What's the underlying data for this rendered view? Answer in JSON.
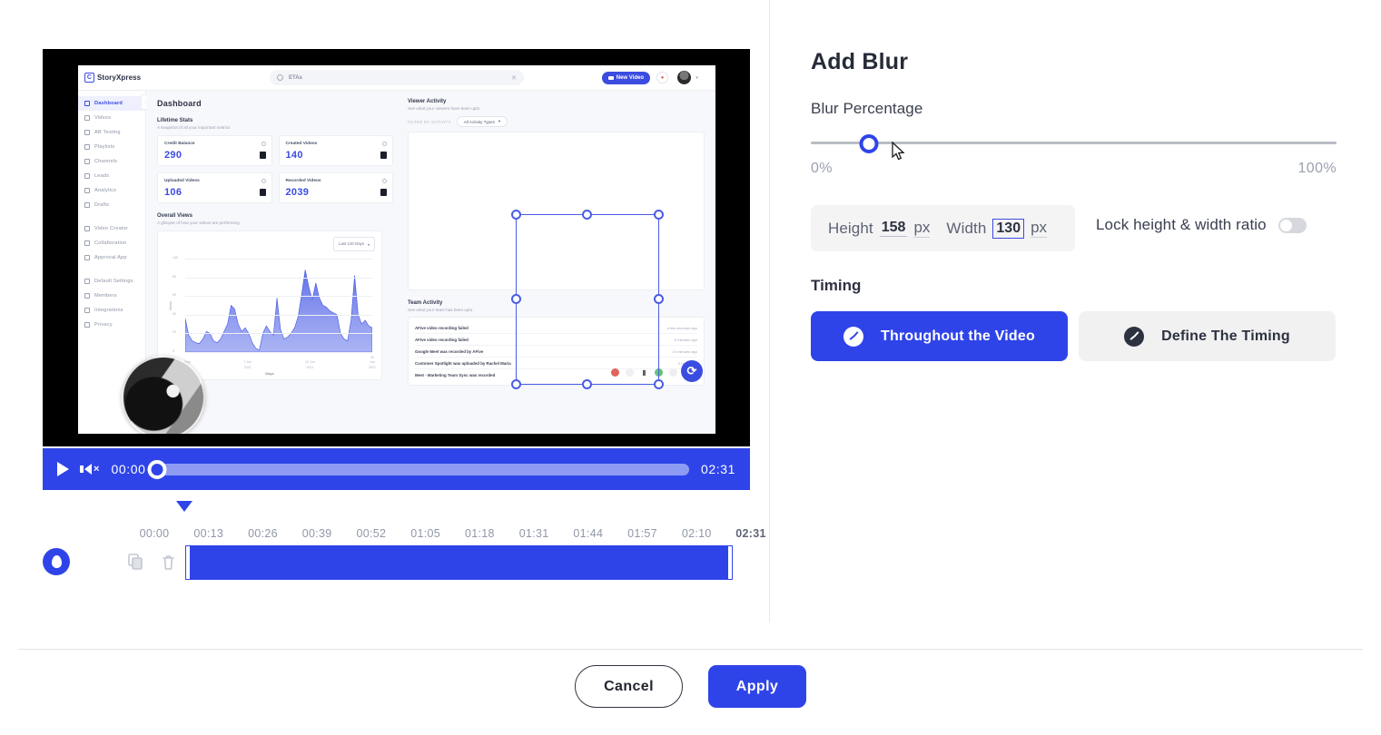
{
  "panel": {
    "title": "Add Blur",
    "blur_percentage_label": "Blur Percentage",
    "slider": {
      "value": 11,
      "min_label": "0%",
      "max_label": "100%",
      "accent": "#2f44e8"
    },
    "dimensions": {
      "height_label": "Height",
      "height_value": "158",
      "height_unit": "px",
      "width_label": "Width",
      "width_value": "130",
      "width_unit": "px",
      "lock_label": "Lock height & width ratio",
      "lock_enabled": "off"
    },
    "timing": {
      "section_label": "Timing",
      "options": [
        {
          "label": "Throughout the Video",
          "icon": "clock-icon",
          "selected": "true"
        },
        {
          "label": "Define The Timing",
          "icon": "clock-icon",
          "selected": "false"
        }
      ]
    }
  },
  "footer": {
    "cancel_label": "Cancel",
    "apply_label": "Apply"
  },
  "player": {
    "current_time": "00:00",
    "total_time": "02:31",
    "progress_percent": 0,
    "play_icon": "play-icon",
    "volume_icon": "volume-muted-icon",
    "muted": "true"
  },
  "timeline": {
    "ticks": [
      "00:00",
      "00:13",
      "00:26",
      "00:39",
      "00:52",
      "01:05",
      "01:18",
      "01:31",
      "01:44",
      "01:57",
      "02:10",
      "02:31"
    ],
    "playhead_time": "00:00",
    "layer_icon": "blur-drop-icon",
    "tools": [
      {
        "name": "duplicate-icon"
      },
      {
        "name": "delete-icon"
      }
    ],
    "clip_start": "00:00",
    "clip_end": "02:31"
  },
  "video_preview": {
    "app_name": "StoryXpress",
    "search_value": "ETAs",
    "new_video_button": "New Video",
    "sidebar": [
      {
        "label": "Dashboard",
        "active": "true"
      },
      {
        "label": "Videos",
        "active": "false"
      },
      {
        "label": "AB Testing",
        "active": "false"
      },
      {
        "label": "Playlists",
        "active": "false"
      },
      {
        "label": "Channels",
        "active": "false"
      },
      {
        "label": "Leads",
        "active": "false"
      },
      {
        "label": "Analytics",
        "active": "false"
      },
      {
        "label": "Drafts",
        "active": "false"
      },
      {
        "label": "Video Creator",
        "active": "false"
      },
      {
        "label": "Collaboration",
        "active": "false"
      },
      {
        "label": "Approval App",
        "active": "false"
      },
      {
        "label": "Default Settings",
        "active": "false"
      },
      {
        "label": "Members",
        "active": "false"
      },
      {
        "label": "Integrations",
        "active": "false"
      },
      {
        "label": "Privacy",
        "active": "false"
      }
    ],
    "page_title": "Dashboard",
    "lifetime_stats": {
      "title": "Lifetime Stats",
      "subtitle": "A snapshot of all your important metrics",
      "cards": [
        {
          "label": "Credit Balance",
          "value": "290"
        },
        {
          "label": "Created Videos",
          "value": "140"
        },
        {
          "label": "Uploaded Videos",
          "value": "106"
        },
        {
          "label": "Recorded Videos",
          "value": "2039"
        }
      ]
    },
    "overall_views": {
      "title": "Overall Views",
      "subtitle": "A glimpse of how your videos are performing",
      "range_select": "Last 120 Days"
    },
    "viewer_activity": {
      "title": "Viewer Activity",
      "subtitle": "See what your viewers have been upto",
      "filter_label": "FILTER BY ACTIVITY",
      "filter_value": "All Activity Types"
    },
    "team_activity": {
      "title": "Team Activity",
      "subtitle": "See what your team has been upto",
      "rows": [
        {
          "text": "AFive video recording failed",
          "time": "a few seconds ago"
        },
        {
          "text": "AFive video recording failed",
          "time": "5 minutes ago"
        },
        {
          "text": "Google Meet was recorded by AFive",
          "time": "10 minutes ago"
        },
        {
          "text": "Customer Spotlight was uploaded by Rachel Maria",
          "time": "2 hours ago"
        },
        {
          "text": "Meet - Marketing Team Sync was recorded",
          "time": ""
        }
      ]
    }
  },
  "chart_data": {
    "type": "area",
    "title": "Overall Views",
    "xlabel": "Days",
    "ylabel": "Views",
    "ylim": [
      0,
      100
    ],
    "y_ticks": [
      0,
      20,
      40,
      60,
      80,
      100
    ],
    "x_ticks": [
      "18 May 2021",
      "7 Jun 2021",
      "15 Jun 2021",
      "30 Jun 2021"
    ],
    "series": [
      {
        "name": "Views",
        "values": [
          36,
          18,
          12,
          10,
          9,
          14,
          22,
          20,
          12,
          10,
          14,
          22,
          30,
          50,
          46,
          30,
          22,
          26,
          20,
          10,
          4,
          2,
          20,
          28,
          22,
          18,
          58,
          24,
          14,
          16,
          20,
          26,
          38,
          62,
          88,
          70,
          56,
          74,
          58,
          50,
          48,
          44,
          42,
          40,
          20,
          14,
          12,
          34,
          82,
          40,
          30,
          34,
          28,
          26
        ]
      }
    ]
  }
}
